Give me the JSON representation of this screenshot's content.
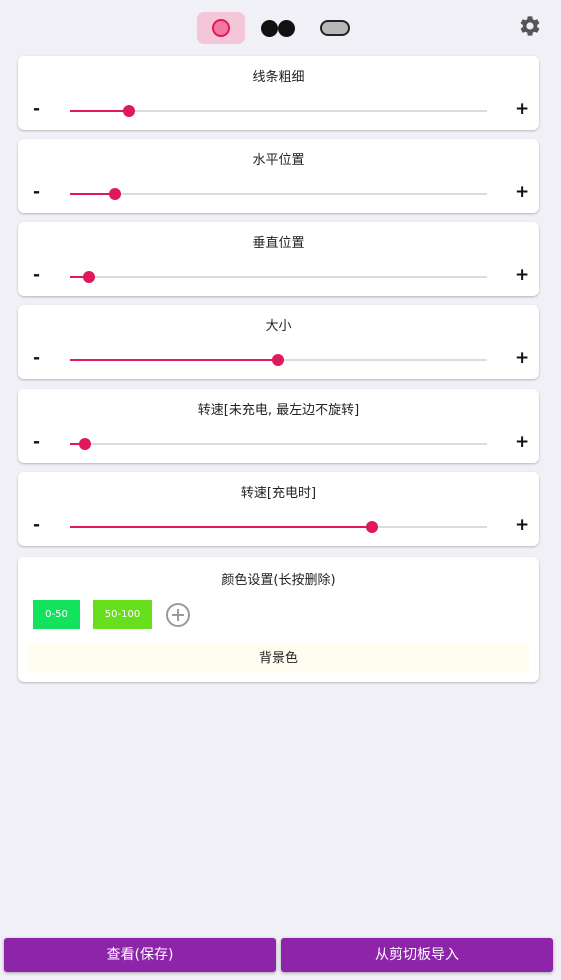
{
  "shape_tabs": [
    {
      "icon": "ring-shape-icon",
      "active": true
    },
    {
      "icon": "dual-dots-shape-icon",
      "active": false
    },
    {
      "icon": "pill-shape-icon",
      "active": false
    }
  ],
  "settings_icon": "gear-icon",
  "slider_minus": "-",
  "slider_plus": "+",
  "sliders": [
    {
      "label": "线条粗细",
      "value": 0.11
    },
    {
      "label": "水平位置",
      "value": 0.075
    },
    {
      "label": "垂直位置",
      "value": 0.01
    },
    {
      "label": "大小",
      "value": 0.48
    },
    {
      "label": "转速[未充电, 最左边不旋转]",
      "value": 0.0
    },
    {
      "label": "转速[充电时]",
      "value": 0.715
    }
  ],
  "color_settings": {
    "title": "颜色设置(长按删除)",
    "chips": [
      {
        "label": "0-50",
        "color": "#13e35c"
      },
      {
        "label": "50-100",
        "color": "#68df1d"
      }
    ],
    "add_icon": "add-circle-icon",
    "background_label": "背景色"
  },
  "buttons": {
    "view_save": "查看(保存)",
    "import_clipboard": "从剪切板导入"
  },
  "colors": {
    "accent": "#e0185c",
    "button": "#8e24aa",
    "active_tab": "#f3c6d8"
  }
}
